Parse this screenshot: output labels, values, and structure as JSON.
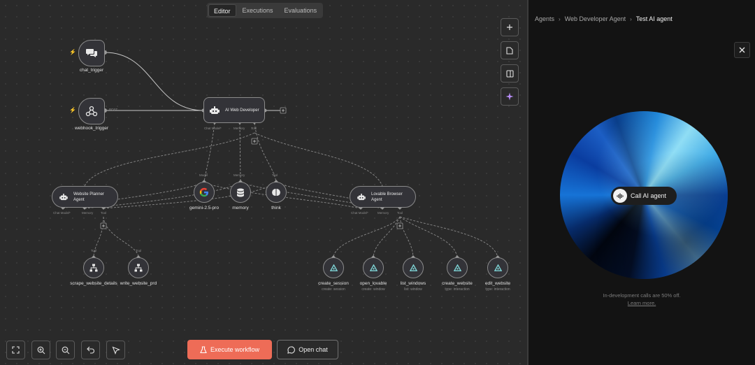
{
  "tabs": [
    {
      "label": "Editor",
      "active": true
    },
    {
      "label": "Executions",
      "active": false
    },
    {
      "label": "Evaluations",
      "active": false
    }
  ],
  "nodes": {
    "chat_trigger": {
      "label": "chat_trigger"
    },
    "webhook_trigger": {
      "label": "webhook_trigger",
      "port": "POST"
    },
    "ai_web_developer": {
      "title": "AI Web Developer",
      "ports": [
        "Chat Model*",
        "Memory",
        "Tool"
      ]
    },
    "website_planner": {
      "title": "Website Planner Agent",
      "ports": [
        "Chat Model*",
        "Memory",
        "Tool"
      ]
    },
    "lovable_browser": {
      "title": "Lovable Browser Agent",
      "ports": [
        "Chat Model*",
        "Memory",
        "Tool"
      ]
    },
    "gemini": {
      "label": "gemini-2.5-pro",
      "port": "Model"
    },
    "memory": {
      "label": "memory",
      "port": "Memory"
    },
    "think": {
      "label": "think",
      "port": "Tool"
    },
    "scrape": {
      "label": "scrape_website_details",
      "port": "Tool"
    },
    "write_prd": {
      "label": "write_website_prd",
      "port": "Tool"
    },
    "create_session": {
      "label": "create_session",
      "sub": "create: session"
    },
    "open_lovable": {
      "label": "open_lovable",
      "sub": "create: window"
    },
    "list_windows": {
      "label": "list_windows",
      "sub": "list: window"
    },
    "create_website": {
      "label": "create_website",
      "sub": "type: interaction"
    },
    "edit_website": {
      "label": "edit_website",
      "sub": "type: interaction"
    }
  },
  "toolbar": {
    "execute_label": "Execute workflow",
    "open_chat_label": "Open chat"
  },
  "panel": {
    "breadcrumbs": [
      "Agents",
      "Web Developer Agent",
      "Test AI agent"
    ],
    "call_label": "Call AI agent",
    "note_line1": "In-development calls are 50% off.",
    "note_line2": "Learn more."
  },
  "colors": {
    "accent": "#ee6c57",
    "canvas_bg": "#2a2a2a",
    "panel_bg": "#131313",
    "trigger_bolt": "#ff6d5a",
    "sparkle": "#b68cf5"
  }
}
